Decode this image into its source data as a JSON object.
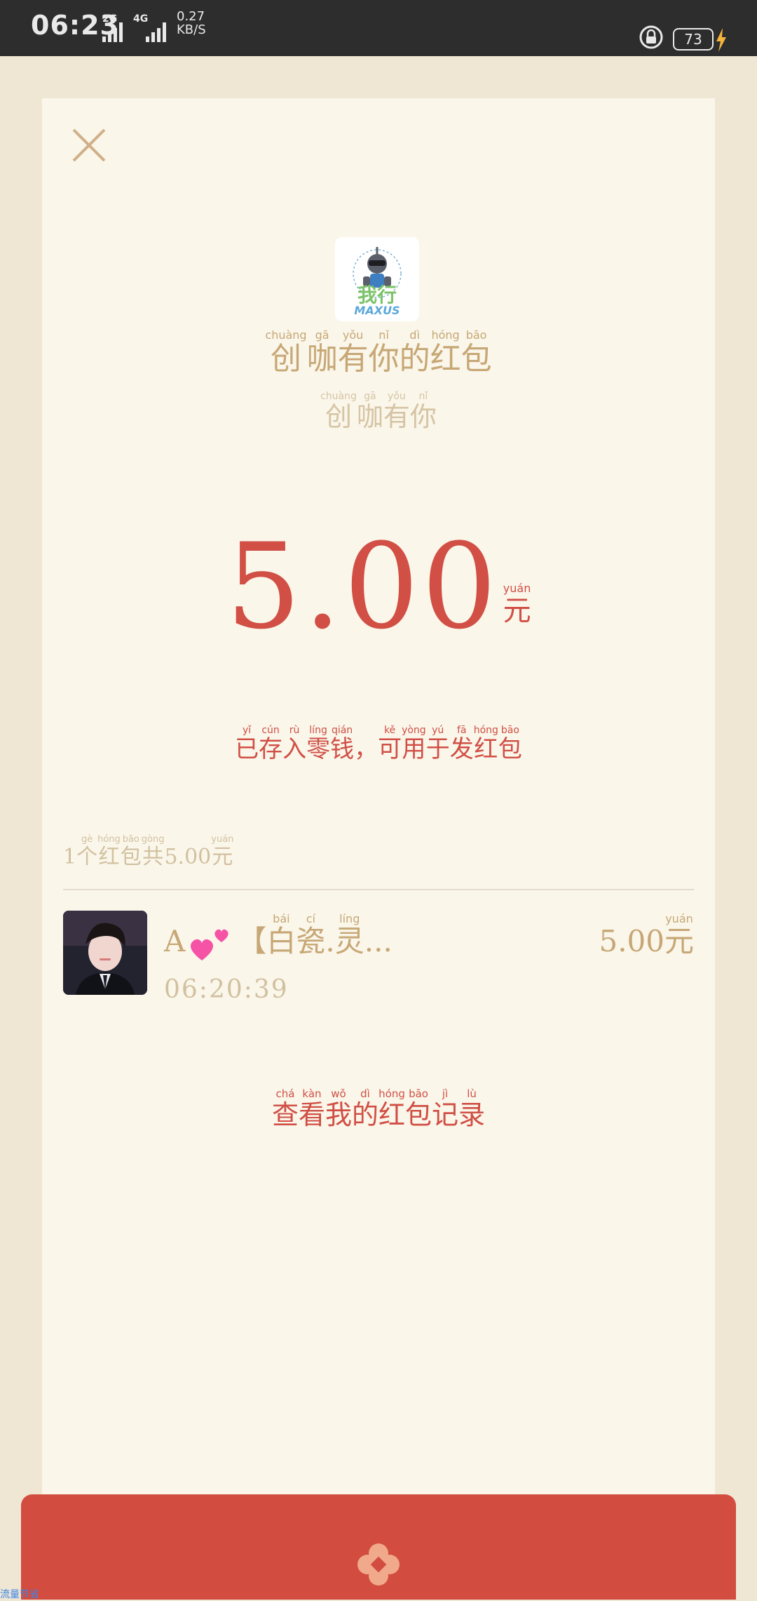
{
  "status_bar": {
    "time": "06:23",
    "net1": "2G",
    "net2": "4G",
    "speed_value": "0.27",
    "speed_unit": "KB/S",
    "battery": "73"
  },
  "packet": {
    "sender_title": [
      {
        "char": "创",
        "py": "chuàng"
      },
      {
        "char": "咖",
        "py": "gā"
      },
      {
        "char": "有",
        "py": "yǒu"
      },
      {
        "char": "你",
        "py": "nǐ"
      },
      {
        "char": "的",
        "py": "dì"
      },
      {
        "char": "红",
        "py": "hóng"
      },
      {
        "char": "包",
        "py": "bāo"
      }
    ],
    "sender_sub": [
      {
        "char": "创",
        "py": "chuàng"
      },
      {
        "char": "咖",
        "py": "gā"
      },
      {
        "char": "有",
        "py": "yǒu"
      },
      {
        "char": "你",
        "py": "nǐ"
      }
    ],
    "amount": "5.00",
    "unit": {
      "char": "元",
      "py": "yuán"
    },
    "deposit_note": [
      {
        "char": "已",
        "py": "yǐ"
      },
      {
        "char": "存",
        "py": "cún"
      },
      {
        "char": "入",
        "py": "rù"
      },
      {
        "char": "零",
        "py": "líng"
      },
      {
        "char": "钱",
        "py": "qián"
      },
      {
        "char": "，",
        "py": ""
      },
      {
        "char": "可",
        "py": "kě"
      },
      {
        "char": "用",
        "py": "yòng"
      },
      {
        "char": "于",
        "py": "yú"
      },
      {
        "char": "发",
        "py": "fā"
      },
      {
        "char": "红",
        "py": "hóng"
      },
      {
        "char": "包",
        "py": "bāo"
      }
    ]
  },
  "summary": [
    {
      "char": "1",
      "py": ""
    },
    {
      "char": "个",
      "py": "gè"
    },
    {
      "char": "红",
      "py": "hóng"
    },
    {
      "char": "包",
      "py": "bāo"
    },
    {
      "char": "共",
      "py": "gòng"
    },
    {
      "char": "5.00",
      "py": ""
    },
    {
      "char": "元",
      "py": "yuán"
    }
  ],
  "record": {
    "name_prefix": "A",
    "name_rest": [
      {
        "char": "【",
        "py": ""
      },
      {
        "char": "白",
        "py": "bái"
      },
      {
        "char": "瓷",
        "py": "cí"
      },
      {
        "char": ".",
        "py": ""
      },
      {
        "char": "灵",
        "py": "líng"
      },
      {
        "char": "...",
        "py": ""
      }
    ],
    "time": "06:20:39",
    "amount": [
      {
        "char": "5.00",
        "py": ""
      },
      {
        "char": "元",
        "py": "yuán"
      }
    ]
  },
  "history_link": [
    {
      "char": "查",
      "py": "chá"
    },
    {
      "char": "看",
      "py": "kàn"
    },
    {
      "char": "我",
      "py": "wǒ"
    },
    {
      "char": "的",
      "py": "dì"
    },
    {
      "char": "红",
      "py": "hóng"
    },
    {
      "char": "包",
      "py": "bāo"
    },
    {
      "char": "记",
      "py": "jì"
    },
    {
      "char": "录",
      "py": "lù"
    }
  ],
  "logo": {
    "text_cn": "我行",
    "text_en": "MAXUS"
  },
  "corner_label": "流量节省",
  "colors": {
    "accent_red": "#d14f45",
    "gold": "#c7a775",
    "envelope_red": "#d24c3f"
  },
  "icons": [
    "close-icon",
    "flower-icon",
    "lock-icon",
    "bolt-icon",
    "signal-icon",
    "hearts-icon"
  ]
}
